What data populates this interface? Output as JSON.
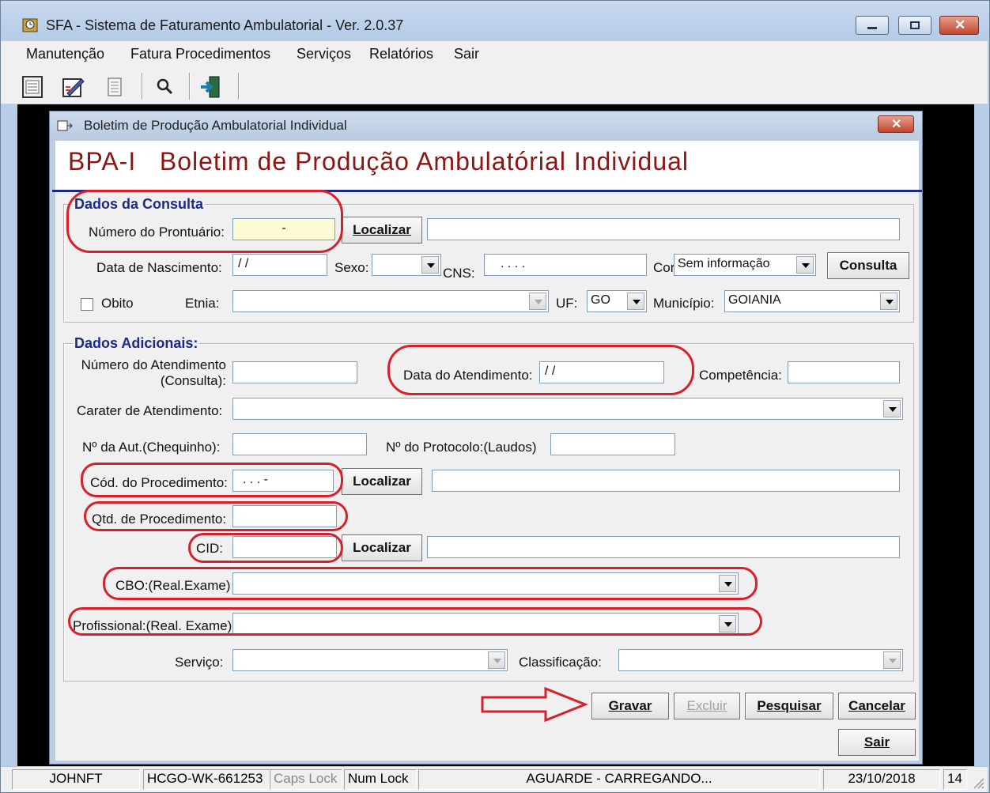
{
  "app": {
    "title": "SFA - Sistema de Faturamento Ambulatorial - Ver. 2.0.37",
    "menu": [
      "Manutenção",
      "Fatura Procedimentos",
      "Serviços",
      "Relatórios",
      "Sair"
    ]
  },
  "dialog": {
    "title": "Boletim de Produção Ambulatorial Individual",
    "header": "BPA-I   Boletim de Produção Ambulatórial Individual",
    "close_glyph": "✕"
  },
  "consulta": {
    "group_title": "Dados da Consulta",
    "prontuario_label": "Número do Prontuário:",
    "prontuario_value": "-",
    "localizar": "Localizar",
    "nascimento_label": "Data de Nascimento:",
    "nascimento_value": "/ /",
    "sexo_label": "Sexo:",
    "cns_label": "CNS:",
    "cns_value": ". . . .",
    "cor_label": "Cor",
    "cor_value": "Sem informação",
    "consulta_button": "Consulta",
    "obito_label": "Obito",
    "etnia_label": "Etnia:",
    "uf_label": "UF:",
    "uf_value": "GO",
    "municipio_label": "Município:",
    "municipio_value": "GOIANIA"
  },
  "adicionais": {
    "group_title": "Dados Adicionais:",
    "num_atendimento_label_1": "Número do Atendimento",
    "num_atendimento_label_2": "(Consulta):",
    "data_atendimento_label": "Data do Atendimento:",
    "data_atendimento_value": "/ /",
    "competencia_label": "Competência:",
    "carater_label": "Carater de Atendimento:",
    "aut_label": "Nº da Aut.(Chequinho):",
    "protocolo_label": "Nº do Protocolo:(Laudos)",
    "cod_proc_label": "Cód. do Procedimento:",
    "cod_proc_value": ". . . -",
    "localizar": "Localizar",
    "qtd_label": "Qtd. de Procedimento:",
    "cid_label": "CID:",
    "cbo_label": "CBO:(Real.Exame)",
    "profissional_label": "Profissional:(Real. Exame)",
    "servico_label": "Serviço:",
    "classificacao_label": "Classificação:"
  },
  "buttons": {
    "gravar": "Gravar",
    "excluir": "Excluir",
    "pesquisar": "Pesquisar",
    "cancelar": "Cancelar",
    "sair": "Sair"
  },
  "status": {
    "user": "JOHNFT",
    "host": "HCGO-WK-661253",
    "caps": "Caps Lock",
    "num": "Num Lock",
    "message": "AGUARDE - CARREGANDO...",
    "date": "23/10/2018",
    "extra": "14"
  },
  "colors": {
    "header_text": "#8b1515",
    "group_title": "#1a2a8a",
    "annotation": "#d81f2a"
  }
}
